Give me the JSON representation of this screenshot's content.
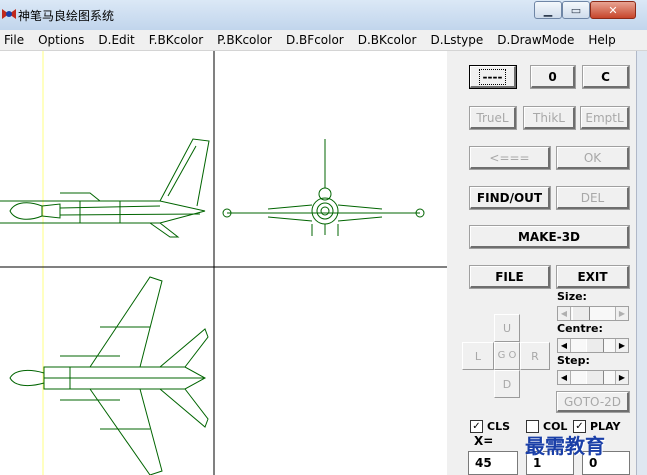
{
  "window": {
    "title": "神笔马良绘图系统",
    "controls": {
      "minimize": "▁",
      "maximize": "▭",
      "close": "✕"
    }
  },
  "menu": [
    "File",
    "Options",
    "D.Edit",
    "F.BKcolor",
    "P.BKcolor",
    "D.BFcolor",
    "D.BKcolor",
    "D.Lstype",
    "D.DrawMode",
    "Help"
  ],
  "buttons": {
    "dash": "----",
    "zero": "0",
    "c": "C",
    "truel": "TrueL",
    "thikl": "ThikL",
    "emptl": "EmptL",
    "back": "<===",
    "ok": "OK",
    "find_out": "FIND/OUT",
    "del": "DEL",
    "make3d": "MAKE-3D",
    "file": "FILE",
    "exit": "EXIT",
    "goto2d": "GOTO-2D"
  },
  "labels": {
    "size": "Size:",
    "centre": "Centre:",
    "step": "Step:",
    "x": "X="
  },
  "dpad": {
    "up": "U",
    "left": "L",
    "go": "G O",
    "right": "R",
    "down": "D"
  },
  "checks": {
    "cls": {
      "label": "CLS",
      "checked": true
    },
    "col": {
      "label": "COL",
      "checked": false
    },
    "play": {
      "label": "PLAY",
      "checked": true
    }
  },
  "fields": {
    "x": "45",
    "second": "1",
    "third": "0"
  },
  "watermark": "最需教育",
  "colors": {
    "drawing": "#006400",
    "guide": "#ffff80",
    "grid": "#000000"
  }
}
